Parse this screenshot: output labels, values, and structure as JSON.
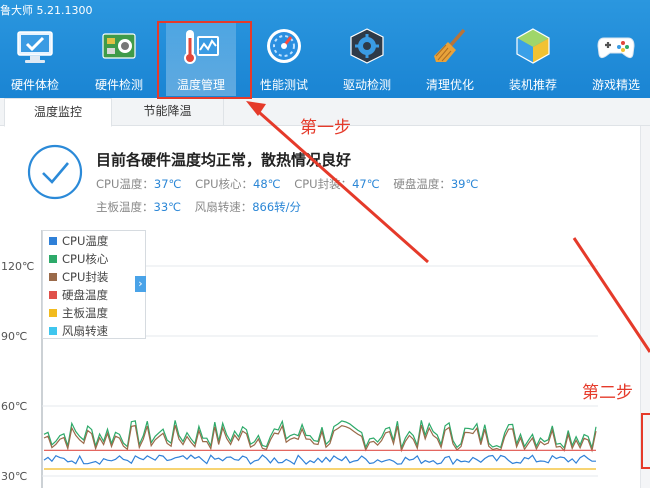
{
  "app": {
    "title": "鲁大师 5.21.1300"
  },
  "toolbar": {
    "items": [
      {
        "label": "硬件体检",
        "icon": "monitor-check-icon"
      },
      {
        "label": "硬件检测",
        "icon": "circuit-board-icon"
      },
      {
        "label": "温度管理",
        "icon": "thermometer-icon",
        "active": true
      },
      {
        "label": "性能测试",
        "icon": "speedometer-icon"
      },
      {
        "label": "驱动检测",
        "icon": "gear-box-icon"
      },
      {
        "label": "清理优化",
        "icon": "broom-icon"
      },
      {
        "label": "装机推荐",
        "icon": "cube-icon"
      },
      {
        "label": "游戏精选",
        "icon": "gamepad-icon"
      }
    ]
  },
  "tabs": {
    "monitor": "温度监控",
    "cooling": "节能降温"
  },
  "status": {
    "headline": "目前各硬件温度均正常，散热情况良好",
    "cpu_temp_label": "CPU温度：",
    "cpu_temp": "37℃",
    "cpu_core_label": "CPU核心：",
    "cpu_core": "48℃",
    "cpu_pkg_label": "CPU封装：",
    "cpu_pkg": "47℃",
    "disk_temp_label": "硬盘温度：",
    "disk_temp": "39℃",
    "board_temp_label": "主板温度：",
    "board_temp": "33℃",
    "fan_label": "风扇转速：",
    "fan": "866转/分"
  },
  "legend": {
    "items": [
      {
        "label": "CPU温度",
        "color": "#2f80d8"
      },
      {
        "label": "CPU核心",
        "color": "#2daa6a"
      },
      {
        "label": "CPU封装",
        "color": "#9a6a4a"
      },
      {
        "label": "硬盘温度",
        "color": "#e0504a"
      },
      {
        "label": "主板温度",
        "color": "#f2bb1e"
      },
      {
        "label": "风扇转速",
        "color": "#3fc6ee"
      }
    ],
    "toggle": "›"
  },
  "chart_data": {
    "type": "line",
    "y_ticks": [
      "120℃",
      "90℃",
      "60℃",
      "30℃"
    ],
    "y_tick_values": [
      120,
      90,
      60,
      30
    ],
    "series": [
      {
        "name": "CPU核心",
        "mean": 48,
        "spread": 6,
        "color": "#2daa6a"
      },
      {
        "name": "CPU封装",
        "mean": 47,
        "spread": 6,
        "color": "#9a6a4a"
      },
      {
        "name": "硬盘温度",
        "mean": 41,
        "spread": 0,
        "color": "#e0504a"
      },
      {
        "name": "CPU温度",
        "mean": 37,
        "spread": 2,
        "color": "#2f80d8"
      },
      {
        "name": "主板温度",
        "mean": 33,
        "spread": 0,
        "color": "#f2bb1e"
      }
    ],
    "grid": true
  },
  "annotations": {
    "step1": "第一步",
    "step2": "第二步",
    "color": "#e53a2a"
  }
}
